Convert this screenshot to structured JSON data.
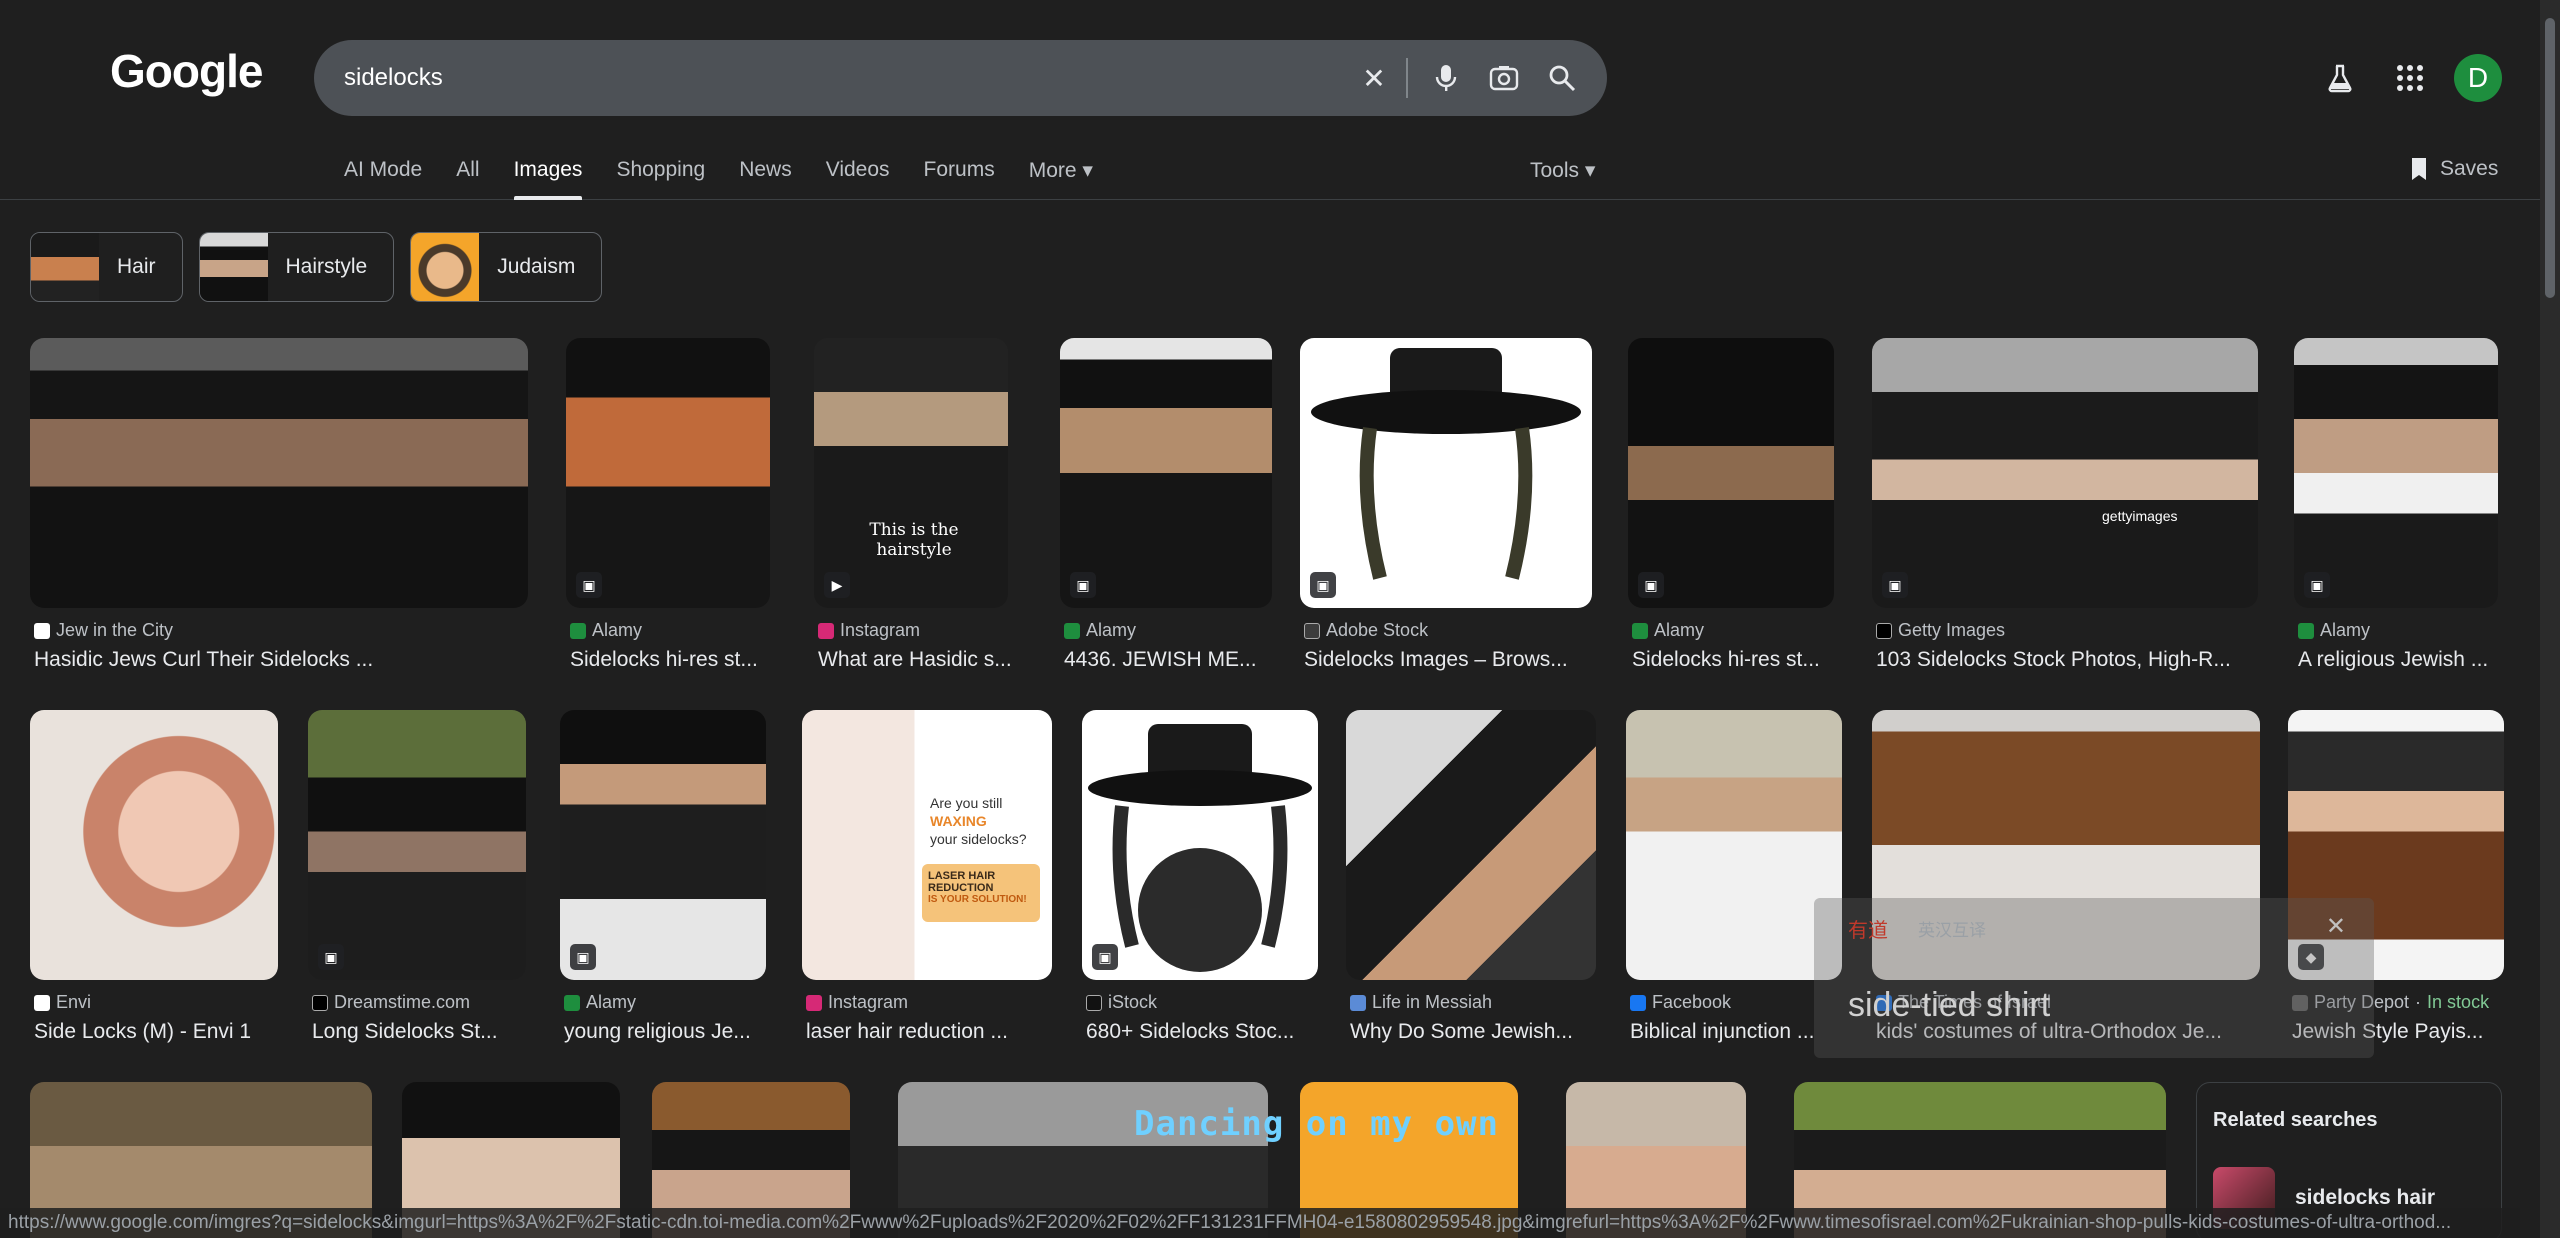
{
  "logo": "Google",
  "search": {
    "query": "sidelocks"
  },
  "tabs": [
    {
      "label": "AI Mode"
    },
    {
      "label": "All"
    },
    {
      "label": "Images"
    },
    {
      "label": "Shopping"
    },
    {
      "label": "News"
    },
    {
      "label": "Videos"
    },
    {
      "label": "Forums"
    },
    {
      "label": "More ▾"
    }
  ],
  "tools": "Tools ▾",
  "saves": "Saves",
  "avatar": "D",
  "chips": [
    {
      "label": "Hair"
    },
    {
      "label": "Hairstyle"
    },
    {
      "label": "Judaism"
    }
  ],
  "row1": [
    {
      "source": "Jew in the City",
      "title": "Hasidic Jews Curl Their Sidelocks ...",
      "overlay": ""
    },
    {
      "source": "Alamy",
      "title": "Sidelocks hi-res st...",
      "overlay": ""
    },
    {
      "source": "Instagram",
      "title": "What are Hasidic s...",
      "overlay": "This is the hairstyle"
    },
    {
      "source": "Alamy",
      "title": "4436. JEWISH ME...",
      "overlay": ""
    },
    {
      "source": "Adobe Stock",
      "title": "Sidelocks Images – Brows...",
      "overlay": ""
    },
    {
      "source": "Alamy",
      "title": "Sidelocks hi-res st...",
      "overlay": ""
    },
    {
      "source": "Getty Images",
      "title": "103 Sidelocks Stock Photos, High-R...",
      "overlay": "gettyimages"
    },
    {
      "source": "Alamy",
      "title": "A religious Jewish ...",
      "overlay": ""
    }
  ],
  "row2": [
    {
      "source": "Envi",
      "title": "Side Locks (M) - Envi 1"
    },
    {
      "source": "Dreamstime.com",
      "title": "Long Sidelocks St..."
    },
    {
      "source": "Alamy",
      "title": "young religious Je..."
    },
    {
      "source": "Instagram",
      "title": "laser hair reduction ...",
      "ad_lines": [
        "Are you still",
        "WAXING",
        "your sidelocks?",
        "LASER HAIR REDUCTION",
        "IS YOUR SOLUTION!"
      ]
    },
    {
      "source": "iStock",
      "title": "680+ Sidelocks Stoc..."
    },
    {
      "source": "Life in Messiah",
      "title": "Why Do Some Jewish..."
    },
    {
      "source": "Facebook",
      "title": "Biblical injunction ..."
    },
    {
      "source": "The Times of Israel",
      "title": "kids' costumes of ultra-Orthodox Je..."
    },
    {
      "source": "Party Depot",
      "stock": "In stock",
      "title": "Jewish Style Payis..."
    }
  ],
  "related": {
    "heading": "Related searches",
    "item": "sidelocks hair"
  },
  "dict": {
    "brand": "有道",
    "mode": "英汉互译",
    "word": "side-tied shirt"
  },
  "caption": "Dancing on my own",
  "status_url": "https://www.google.com/imgres?q=sidelocks&imgurl=https%3A%2F%2Fstatic-cdn.toi-media.com%2Fwww%2Fuploads%2F2020%2F02%2FF131231FFMH04-e1580802959548.jpg&imgrefurl=https%3A%2F%2Fwww.timesofisrael.com%2Fukrainian-shop-pulls-kids-costumes-of-ultra-orthod..."
}
